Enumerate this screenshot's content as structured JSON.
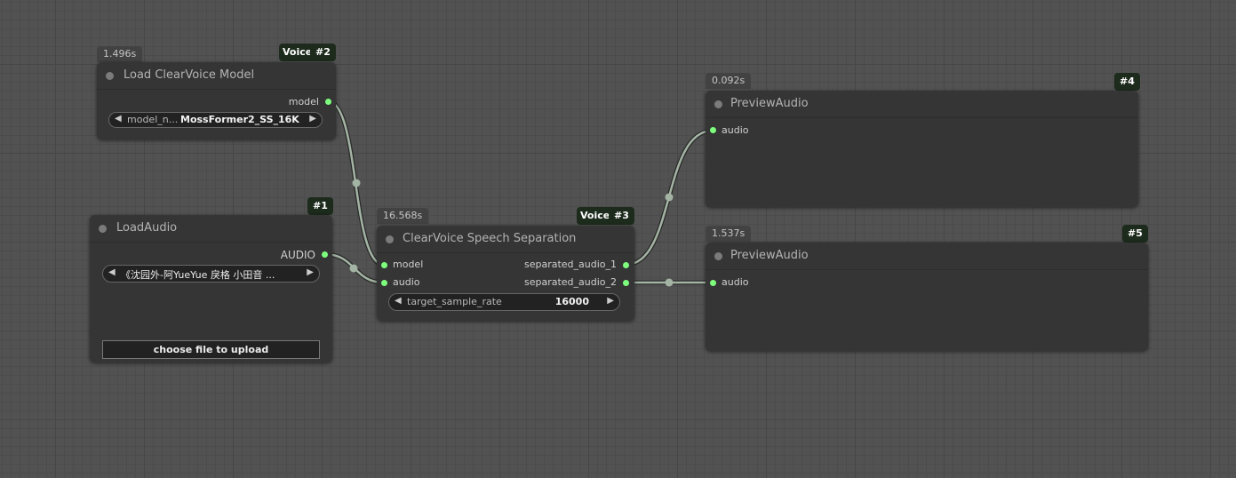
{
  "colors": {
    "canvas": "#525252",
    "node_bg": "#353535",
    "slot_connected": "#7dff7d",
    "link": "#a4b4a4",
    "badge_bg": "#1d2b1d"
  },
  "nodes": {
    "load_model": {
      "title": "Load ClearVoice Model",
      "time": "1.496s",
      "tag": "Voice",
      "id": "#2",
      "outputs": [
        "model"
      ],
      "widget": {
        "name": "model_n...",
        "value": "MossFormer2_SS_16K"
      }
    },
    "load_audio": {
      "title": "LoadAudio",
      "id": "#1",
      "outputs": [
        "AUDIO"
      ],
      "widget": {
        "value": "《沈园外-阿YueYue 戾格 小田音  ..."
      },
      "upload_label": "choose file to upload"
    },
    "separation": {
      "title": "ClearVoice Speech Separation",
      "time": "16.568s",
      "tag": "Voice",
      "id": "#3",
      "inputs": [
        "model",
        "audio"
      ],
      "outputs": [
        "separated_audio_1",
        "separated_audio_2"
      ],
      "widget": {
        "name": "target_sample_rate",
        "value": "16000"
      }
    },
    "preview1": {
      "title": "PreviewAudio",
      "time": "0.092s",
      "id": "#4",
      "inputs": [
        "audio"
      ]
    },
    "preview2": {
      "title": "PreviewAudio",
      "time": "1.537s",
      "id": "#5",
      "inputs": [
        "audio"
      ]
    }
  }
}
